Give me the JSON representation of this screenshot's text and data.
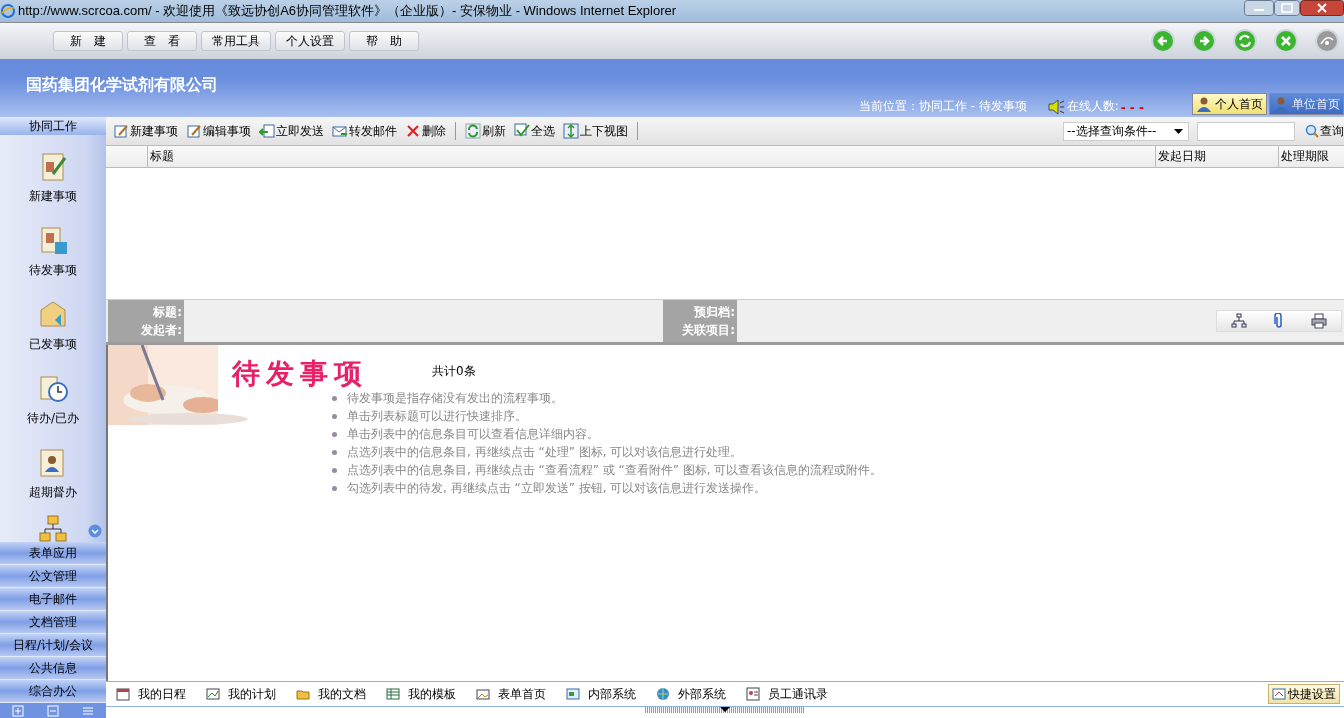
{
  "window": {
    "title": "http://www.scrcoa.com/ - 欢迎使用《致远协创A6协同管理软件》（企业版）- 安保物业 - Windows Internet Explorer"
  },
  "menu": [
    "新　建",
    "查　看",
    "常用工具",
    "个人设置",
    "帮　助"
  ],
  "banner": {
    "company": "国药集团化学试剂有限公司",
    "location": "当前位置：协同工作 - 待发事项",
    "online_label": "在线人数:",
    "online_count": "- - -",
    "home_tabs": [
      {
        "label": "个人首页",
        "selected": true
      },
      {
        "label": "单位首页",
        "selected": false
      }
    ]
  },
  "sidebar": {
    "header": "协同工作",
    "items": [
      {
        "label": "新建事项"
      },
      {
        "label": "待发事项"
      },
      {
        "label": "已发事项"
      },
      {
        "label": "待办/已办"
      },
      {
        "label": "超期督办"
      }
    ],
    "sections": [
      "表单应用",
      "公文管理",
      "电子邮件",
      "文档管理",
      "日程/计划/会议",
      "公共信息",
      "综合办公"
    ]
  },
  "toolbar": [
    "新建事项",
    "编辑事项",
    "立即发送",
    "转发邮件",
    "删除",
    "刷新",
    "全选",
    "上下视图"
  ],
  "search": {
    "condition": "--选择查询条件--",
    "button": "查询"
  },
  "table": {
    "columns": [
      "标题",
      "发起日期",
      "处理期限"
    ]
  },
  "detail": {
    "left_labels": [
      "标题:",
      "发起者:"
    ],
    "right_labels": [
      "预归档:",
      "关联项目:"
    ]
  },
  "intro": {
    "heading": "待发事项",
    "count": "共计0条",
    "tips": [
      "待发事项是指存储没有发出的流程事项。",
      "单击列表标题可以进行快速排序。",
      "单击列表中的信息条目可以查看信息详细内容。",
      "点选列表中的信息条目, 再继续点击 “处理” 图标, 可以对该信息进行处理。",
      "点选列表中的信息条目, 再继续点击 “查看流程” 或 “查看附件” 图标, 可以查看该信息的流程或附件。",
      "勾选列表中的待发, 再继续点击 “立即发送” 按钮, 可以对该信息进行发送操作。"
    ]
  },
  "quickbar": [
    "我的日程",
    "我的计划",
    "我的文档",
    "我的模板",
    "表单首页",
    "内部系统",
    "外部系统",
    "员工通讯录"
  ],
  "quick_settings": "快捷设置"
}
